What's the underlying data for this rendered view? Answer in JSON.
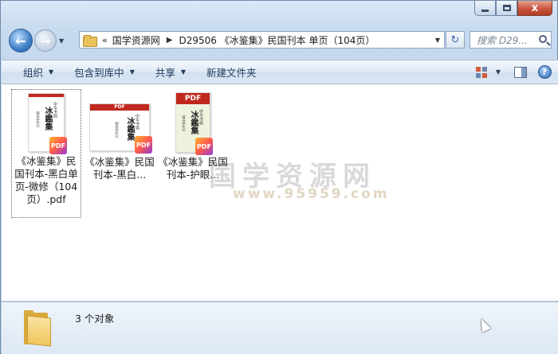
{
  "window": {
    "caption_close": "x"
  },
  "nav": {
    "back_glyph": "←",
    "forward_glyph": "→",
    "refresh_glyph": "↻"
  },
  "address": {
    "prefix": "«",
    "crumbs": [
      "国学资源网",
      "D29506 《冰鉴集》民国刊本 单页（104页）"
    ]
  },
  "search": {
    "placeholder": "搜索 D29..."
  },
  "toolbar": {
    "organize": "组织",
    "include_in_library": "包含到库中",
    "share": "共享",
    "new_folder": "新建文件夹"
  },
  "watermark": {
    "text": "国学资源网",
    "url": "www.95959.com"
  },
  "files": [
    {
      "label": "《冰鉴集》民国刊本-黑白单页-微修（104页）.pdf",
      "thumb_title": "冰鑑集",
      "badge": "PDF"
    },
    {
      "label": "《冰鉴集》民国刊本-黑白...",
      "thumb_title": "冰鑑集",
      "badge": "PDF",
      "bar": "PDF"
    },
    {
      "label": "《冰鉴集》民国刊本-护眼...",
      "thumb_title": "冰鑑集",
      "badge": "PDF",
      "bar": "PDF"
    }
  ],
  "status": {
    "count": "3 个对象"
  },
  "colors": {
    "toolbar_text": "#1e395b",
    "pdf_bar": "#c0281e",
    "close_button": "#c9553e"
  }
}
